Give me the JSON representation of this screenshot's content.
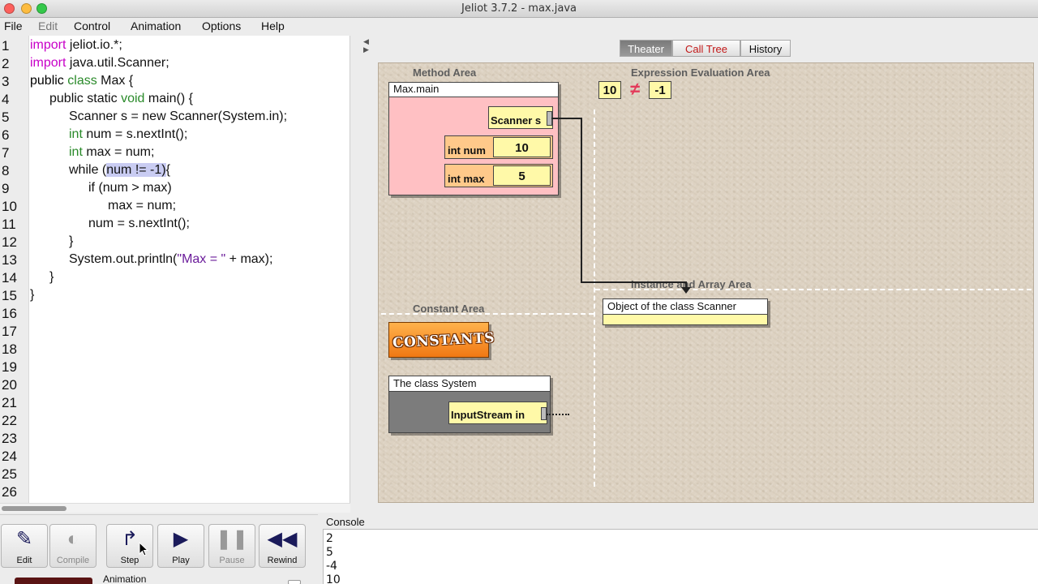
{
  "window": {
    "title": "Jeliot 3.7.2 - max.java"
  },
  "menu": [
    "File",
    "Edit",
    "Control",
    "Animation",
    "Options",
    "Help"
  ],
  "editor": {
    "line_numbers": [
      "1",
      "2",
      "3",
      "4",
      "5",
      "6",
      "7",
      "8",
      "9",
      "10",
      "11",
      "12",
      "13",
      "14",
      "15",
      "16",
      "17",
      "18",
      "19",
      "20",
      "21",
      "22",
      "23",
      "24",
      "25",
      "26"
    ],
    "code": {
      "l1_kw": "import",
      "l1_rest": " jeliot.io.*;",
      "l2_kw": "import",
      "l2_rest": " java.util.Scanner;",
      "l3_kw1": "public",
      "l3_kw2": "class",
      "l3_rest": " Max {",
      "l4_kw1": "public",
      "l4_kw2": "static",
      "l4_kw3": "void",
      "l4_rest": " main() {",
      "l5_pre": "Scanner s = ",
      "l5_kw": "new",
      "l5_rest": " Scanner(System.in);",
      "l6_kw": "int",
      "l6_rest": " num = s.nextInt();",
      "l7_kw": "int",
      "l7_rest": " max = num;",
      "l8_kw": "while",
      "l8_open": " (",
      "l8_hl": "num != -1)",
      "l8_rest": "{",
      "l9_kw": "if",
      "l9_rest": " (num > max)",
      "l10": "max = num;",
      "l11": "num = s.nextInt();",
      "l12": "}",
      "l13_pre": "System.out.println(",
      "l13_str": "\"Max = \"",
      "l13_rest": " + max);",
      "l14": "}",
      "l15": "}"
    }
  },
  "theater": {
    "tabs": [
      "Theater",
      "Call Tree",
      "History"
    ],
    "areas": {
      "method": "Method Area",
      "expression": "Expression Evaluation Area",
      "instance": "Instance and Array Area",
      "constant": "Constant Area"
    },
    "method_frame": {
      "title": "Max.main",
      "vars": [
        {
          "type_name": "Scanner s",
          "value": ""
        },
        {
          "type_name": "int num",
          "value": "10"
        },
        {
          "type_name": "int max",
          "value": "5"
        }
      ]
    },
    "expression": {
      "left": "10",
      "op": "≠",
      "right": "-1"
    },
    "instance": {
      "title": "Object of the class Scanner"
    },
    "constants_label": "CONSTANTS",
    "system_class": {
      "title": "The class System",
      "field": "InputStream in"
    },
    "colors": {
      "frame_bg": "#ffc0c3",
      "var_bg": "#fff9a8",
      "var_label_bg": "#ffc98a",
      "system_bg": "#7c7c7c"
    }
  },
  "controls": {
    "buttons": [
      {
        "label": "Edit",
        "icon": "edit-icon",
        "enabled": true
      },
      {
        "label": "Compile",
        "icon": "compile-icon",
        "enabled": false
      },
      {
        "label": "Step",
        "icon": "step-icon",
        "enabled": true
      },
      {
        "label": "Play",
        "icon": "play-icon",
        "enabled": true
      },
      {
        "label": "Pause",
        "icon": "pause-icon",
        "enabled": false
      },
      {
        "label": "Rewind",
        "icon": "rewind-icon",
        "enabled": true
      }
    ],
    "animation_label": "Animation"
  },
  "console": {
    "label": "Console",
    "lines": [
      "2",
      "5",
      "-4",
      "10"
    ]
  }
}
